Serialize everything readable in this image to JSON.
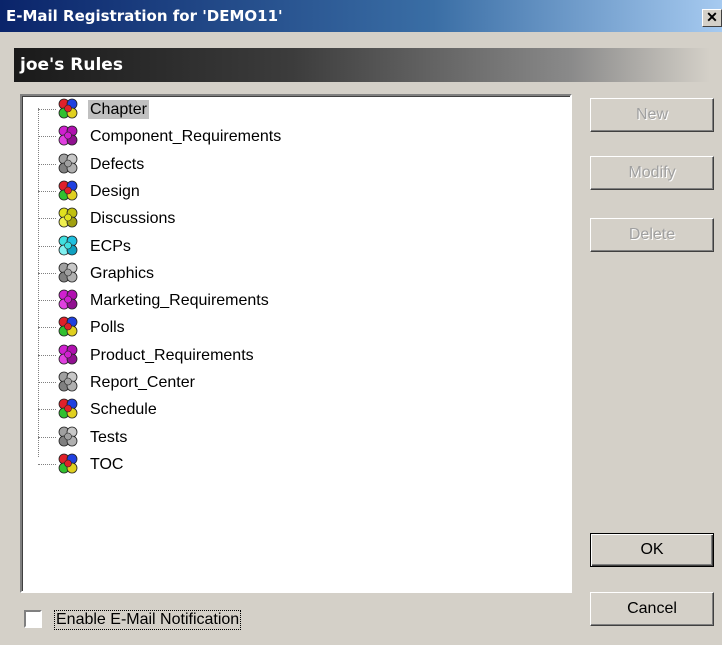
{
  "window": {
    "title": "E-Mail Registration for 'DEMO11'",
    "close_symbol": "✕"
  },
  "header": {
    "label": "joe's Rules"
  },
  "tree": {
    "items": [
      {
        "label": "Chapter",
        "icon": "rules-cube-icon",
        "colors": [
          "#e0202a",
          "#2040e0",
          "#30c030",
          "#e0d020"
        ],
        "selected": true
      },
      {
        "label": "Component_Requirements",
        "icon": "rules-cube-icon",
        "colors": [
          "#d020d0",
          "#b010b0",
          "#e040e0",
          "#901090"
        ],
        "selected": false
      },
      {
        "label": "Defects",
        "icon": "rules-cube-icon",
        "colors": [
          "#a0a0a0",
          "#c8c8c8",
          "#808080",
          "#b0b0b0"
        ],
        "selected": false
      },
      {
        "label": "Design",
        "icon": "rules-cube-icon",
        "colors": [
          "#e0202a",
          "#2040e0",
          "#30c030",
          "#e0d020"
        ],
        "selected": false
      },
      {
        "label": "Discussions",
        "icon": "rules-cube-icon",
        "colors": [
          "#e0e020",
          "#c0c010",
          "#f0f050",
          "#a0a010"
        ],
        "selected": false
      },
      {
        "label": "ECPs",
        "icon": "rules-cube-icon",
        "colors": [
          "#40e0e0",
          "#20c0e0",
          "#80f0f0",
          "#10a0c0"
        ],
        "selected": false
      },
      {
        "label": "Graphics",
        "icon": "rules-cube-icon",
        "colors": [
          "#a0a0a0",
          "#c8c8c8",
          "#808080",
          "#b0b0b0"
        ],
        "selected": false
      },
      {
        "label": "Marketing_Requirements",
        "icon": "rules-cube-icon",
        "colors": [
          "#d020d0",
          "#b010b0",
          "#e040e0",
          "#901090"
        ],
        "selected": false
      },
      {
        "label": "Polls",
        "icon": "rules-cube-icon",
        "colors": [
          "#e0202a",
          "#2040e0",
          "#30c030",
          "#e0d020"
        ],
        "selected": false
      },
      {
        "label": "Product_Requirements",
        "icon": "rules-cube-icon",
        "colors": [
          "#d020d0",
          "#b010b0",
          "#e040e0",
          "#901090"
        ],
        "selected": false
      },
      {
        "label": "Report_Center",
        "icon": "rules-cube-icon",
        "colors": [
          "#a0a0a0",
          "#c8c8c8",
          "#808080",
          "#b0b0b0"
        ],
        "selected": false
      },
      {
        "label": "Schedule",
        "icon": "rules-cube-icon",
        "colors": [
          "#e0202a",
          "#2040e0",
          "#30c030",
          "#e0d020"
        ],
        "selected": false
      },
      {
        "label": "Tests",
        "icon": "rules-cube-icon",
        "colors": [
          "#a0a0a0",
          "#c8c8c8",
          "#808080",
          "#b0b0b0"
        ],
        "selected": false
      },
      {
        "label": "TOC",
        "icon": "rules-cube-icon",
        "colors": [
          "#e0202a",
          "#2040e0",
          "#30c030",
          "#e0d020"
        ],
        "selected": false
      }
    ]
  },
  "buttons": {
    "new_label": "New",
    "modify_label": "Modify",
    "delete_label": "Delete",
    "ok_label": "OK",
    "cancel_label": "Cancel"
  },
  "notification": {
    "label": "Enable E-Mail Notification",
    "checked": false
  }
}
